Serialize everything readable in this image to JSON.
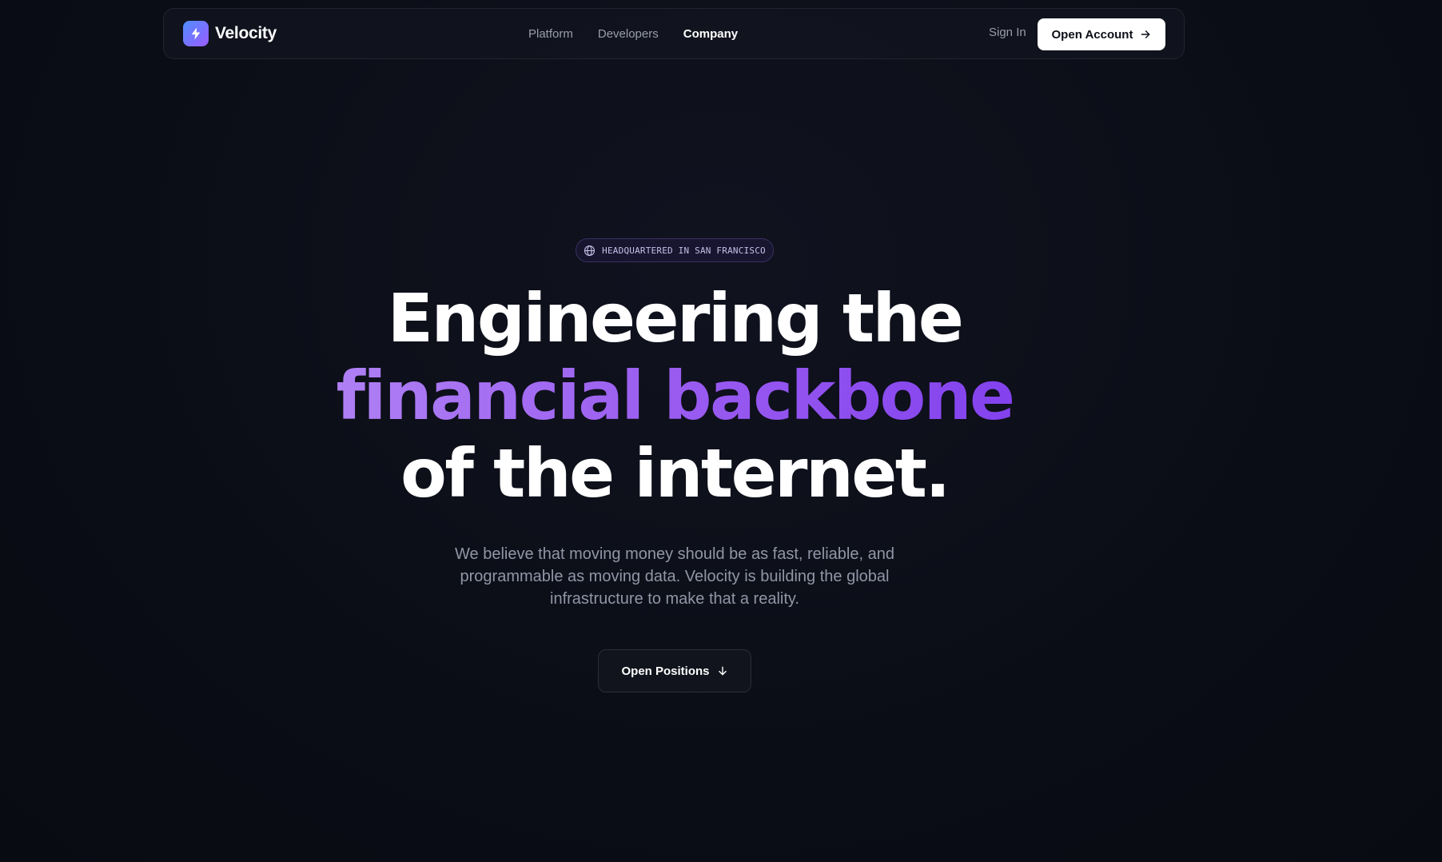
{
  "nav": {
    "brand": "Velocity",
    "links": [
      {
        "label": "Platform",
        "active": false
      },
      {
        "label": "Developers",
        "active": false
      },
      {
        "label": "Company",
        "active": true
      }
    ],
    "sign_in": "Sign In",
    "cta": "Open Account",
    "icons": {
      "logo": "lightning-bolt-icon",
      "cta": "arrow-right-icon"
    }
  },
  "hero": {
    "badge": {
      "icon": "globe-icon",
      "text": "HEADQUARTERED IN SAN FRANCISCO"
    },
    "headline": {
      "line1": "Engineering the",
      "line2": "financial backbone",
      "line3": "of the internet."
    },
    "subtext": "We believe that moving money should be as fast, reliable, and programmable as moving data. Velocity is building the global infrastructure to make that a reality.",
    "cta": {
      "label": "Open Positions",
      "icon": "arrow-down-icon"
    }
  },
  "colors": {
    "background": "#0c0e18",
    "accent_start": "#b48af5",
    "accent_end": "#7c3aed",
    "logo_start": "#4f8dff",
    "logo_end": "#9b5cff",
    "muted_text": "#9196a6"
  }
}
